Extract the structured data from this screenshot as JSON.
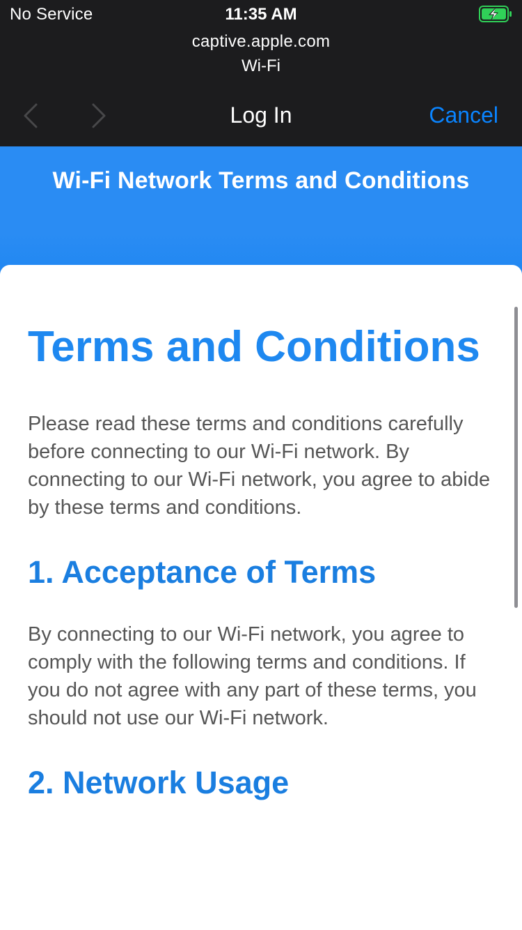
{
  "status_bar": {
    "carrier": "No Service",
    "time": "11:35 AM",
    "battery_icon": "battery-charging-icon",
    "battery_color": "#30d158"
  },
  "header": {
    "url": "captive.apple.com",
    "subtitle": "Wi-Fi",
    "title": "Log In",
    "cancel_label": "Cancel",
    "back_icon": "chevron-left-icon",
    "forward_icon": "chevron-right-icon",
    "accent_color": "#0a84ff"
  },
  "page": {
    "banner_title": "Wi-Fi Network Terms and Conditions",
    "banner_color": "#2a8cf3",
    "heading": "Terms and Conditions",
    "intro": "Please read these terms and conditions carefully before connecting to our Wi-Fi network. By connecting to our Wi-Fi network, you agree to abide by these terms and conditions.",
    "sections": [
      {
        "title": "1. Acceptance of Terms",
        "body": "By connecting to our Wi-Fi network, you agree to comply with the following terms and conditions. If you do not agree with any part of these terms, you should not use our Wi-Fi network."
      },
      {
        "title": "2. Network Usage",
        "body": ""
      }
    ]
  }
}
